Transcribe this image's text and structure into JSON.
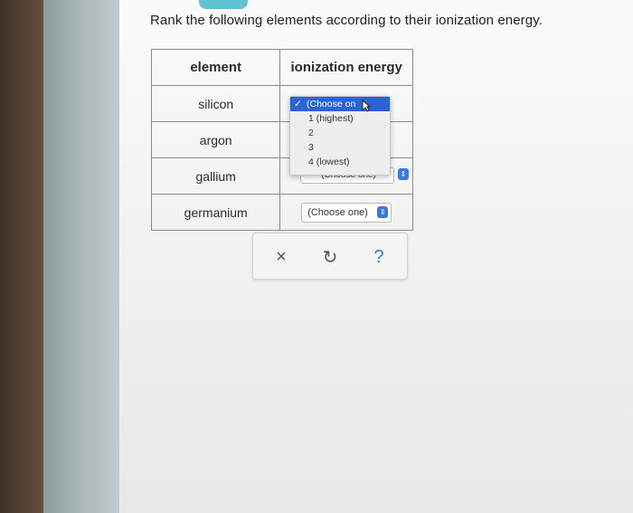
{
  "question": "Rank the following elements according to their ionization energy.",
  "table": {
    "headers": [
      "element",
      "ionization energy"
    ],
    "rows": [
      {
        "element": "silicon",
        "choice": "(Choose one)"
      },
      {
        "element": "argon",
        "choice": "(Choose one)"
      },
      {
        "element": "gallium",
        "choice": "(Choose one)"
      },
      {
        "element": "germanium",
        "choice": "(Choose one)"
      }
    ]
  },
  "dropdown": {
    "selected": "(Choose on",
    "check": "✓",
    "options": [
      "1 (highest)",
      "2",
      "3",
      "4 (lowest)"
    ]
  },
  "actions": {
    "close_icon": "×",
    "undo_icon": "↻",
    "help_icon": "?"
  },
  "colors": {
    "accent": "#2b63d6",
    "help": "#3877d6",
    "tab": "#5fc3d2"
  }
}
